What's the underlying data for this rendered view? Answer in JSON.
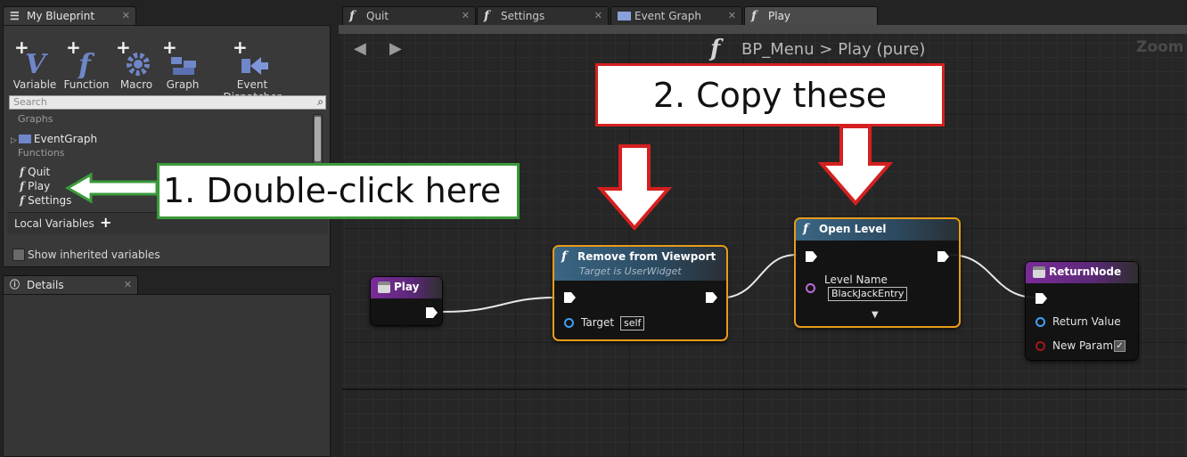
{
  "left_tabs": {
    "my_blueprint": "My Blueprint",
    "details": "Details",
    "close": "✕"
  },
  "toolbar": [
    {
      "label": "Variable",
      "icon": "add-variable-icon"
    },
    {
      "label": "Function",
      "icon": "add-function-icon"
    },
    {
      "label": "Macro",
      "icon": "add-macro-icon"
    },
    {
      "label": "Graph",
      "icon": "add-graph-icon"
    },
    {
      "label": "Event Dispatcher",
      "icon": "add-event-dispatcher-icon"
    }
  ],
  "search": {
    "placeholder": "Search"
  },
  "tree": {
    "graphs_label": "Graphs",
    "event_graph": "EventGraph",
    "functions_label": "Functions",
    "functions": [
      "Quit",
      "Play",
      "Settings"
    ],
    "local_variables": "Local Variables",
    "add_symbol": "+",
    "show_inherited": "Show inherited variables"
  },
  "doc_tabs": [
    {
      "label": "Quit",
      "icon": "f"
    },
    {
      "label": "Settings",
      "icon": "f"
    },
    {
      "label": "Event Graph",
      "icon": "grid"
    },
    {
      "label": "Play",
      "icon": "f",
      "active": true
    }
  ],
  "breadcrumb": {
    "icon": "f",
    "root": "BP_Menu",
    "separator": ">",
    "current": "Play (pure)",
    "zoom": "Zoom"
  },
  "nav": {
    "back": "◀",
    "forward": "▶"
  },
  "nodes": {
    "play": {
      "title": "Play"
    },
    "remove": {
      "title": "Remove from Viewport",
      "subtitle": "Target is UserWidget",
      "target_label": "Target",
      "target_value": "self"
    },
    "open_level": {
      "title": "Open Level",
      "pin_label": "Level Name",
      "pin_value": "BlackJackEntry",
      "expand": "▼"
    },
    "return": {
      "title": "ReturnNode",
      "pin1": "Return Value",
      "pin2": "New Param",
      "check": "✓"
    }
  },
  "annotations": {
    "step1": "1. Double-click here",
    "step2": "2. Copy these"
  },
  "colors": {
    "selected_border": "#e79c19",
    "annotation_green": "#3a9a3a",
    "annotation_red": "#d42020"
  }
}
